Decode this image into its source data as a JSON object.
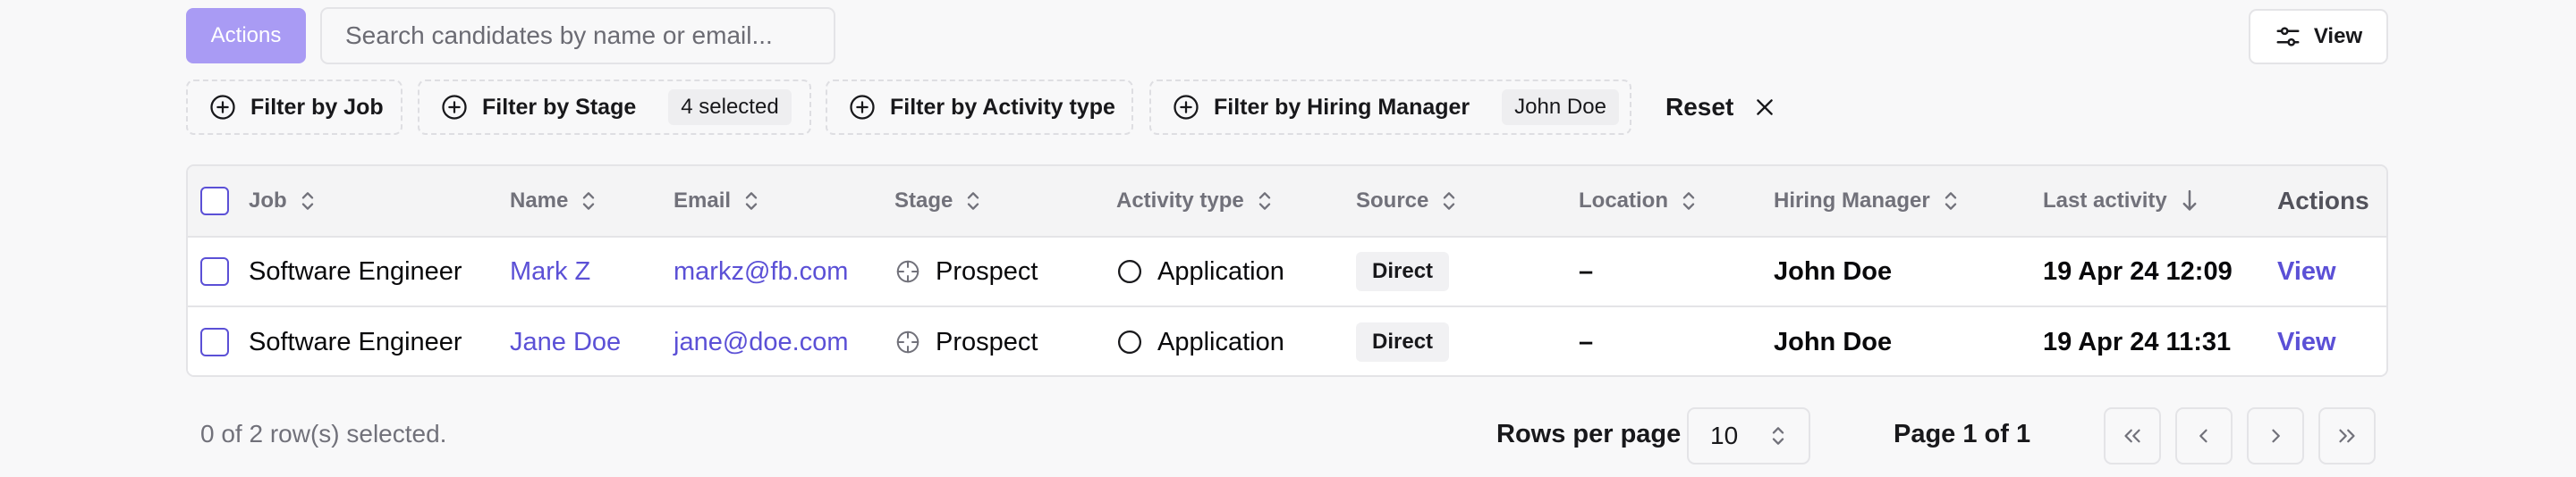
{
  "toolbar": {
    "actions_label": "Actions",
    "search_placeholder": "Search candidates by name or email...",
    "view_label": "View"
  },
  "filters": {
    "job": {
      "label": "Filter by Job"
    },
    "stage": {
      "label": "Filter by Stage",
      "chip": "4 selected"
    },
    "activity_type": {
      "label": "Filter by Activity type"
    },
    "hiring_manager": {
      "label": "Filter by Hiring Manager",
      "chip": "John Doe"
    },
    "reset_label": "Reset"
  },
  "table": {
    "columns": {
      "job": "Job",
      "name": "Name",
      "email": "Email",
      "stage": "Stage",
      "activity_type": "Activity type",
      "source": "Source",
      "location": "Location",
      "hiring_manager": "Hiring Manager",
      "last_activity": "Last activity",
      "actions": "Actions"
    },
    "rows": [
      {
        "job": "Software Engineer",
        "name": "Mark Z",
        "email": "markz@fb.com",
        "stage": "Prospect",
        "activity_type": "Application",
        "source": "Direct",
        "location": "–",
        "hiring_manager": "John Doe",
        "last_activity": "19 Apr 24 12:09",
        "action": "View"
      },
      {
        "job": "Software Engineer",
        "name": "Jane Doe",
        "email": "jane@doe.com",
        "stage": "Prospect",
        "activity_type": "Application",
        "source": "Direct",
        "location": "–",
        "hiring_manager": "John Doe",
        "last_activity": "19 Apr 24 11:31",
        "action": "View"
      }
    ]
  },
  "footer": {
    "selection_text": "0 of 2 row(s) selected.",
    "rows_per_page_label": "Rows per page",
    "rows_per_page_value": "10",
    "page_text": "Page 1 of 1"
  },
  "colors": {
    "accent": "#5b50d6",
    "actions_button": "#a99bf4"
  },
  "icons": [
    "sliders-icon",
    "plus-circle-icon",
    "close-icon",
    "sort-icon",
    "sort-down-icon",
    "crosshair-icon",
    "circle-icon",
    "chevrons-up-down-icon",
    "first-page-icon",
    "prev-page-icon",
    "next-page-icon",
    "last-page-icon"
  ]
}
